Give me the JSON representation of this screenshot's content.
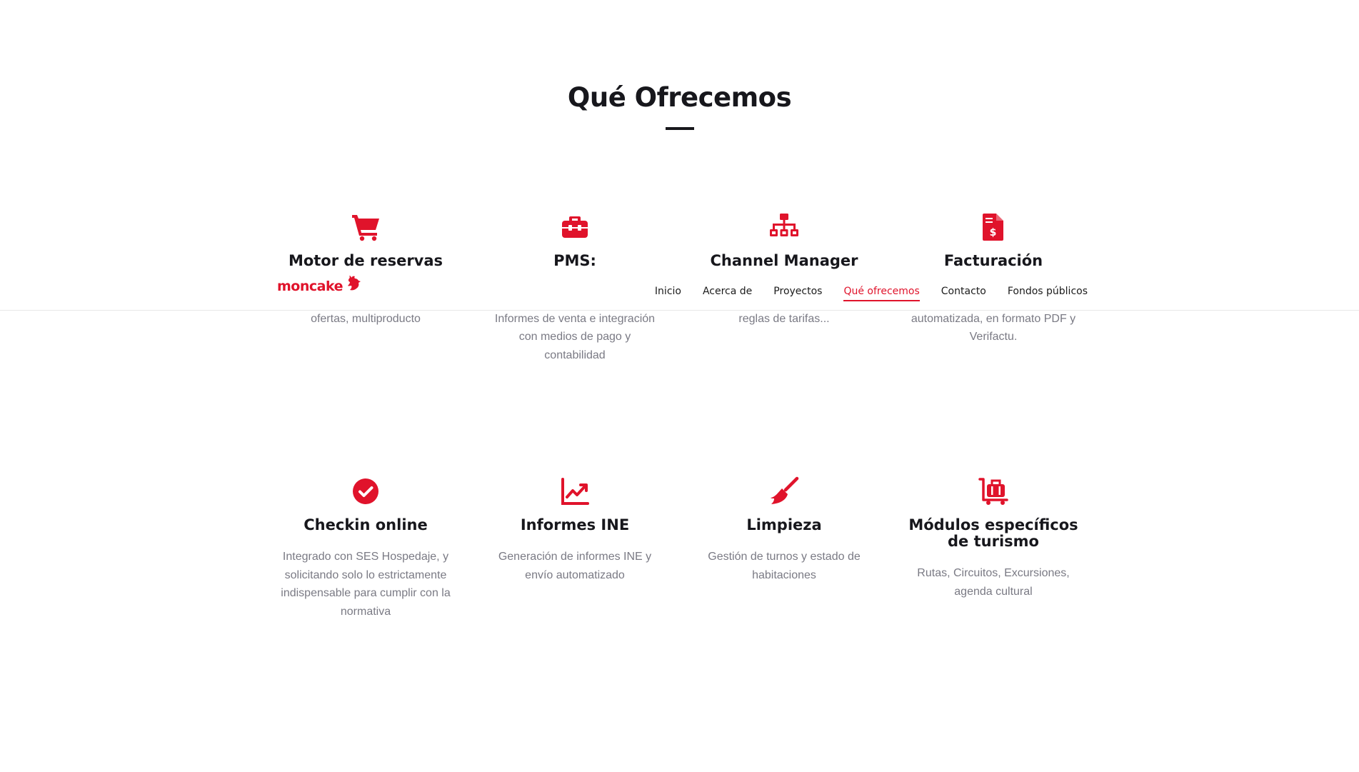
{
  "section": {
    "title": "Qué Ofrecemos"
  },
  "colors": {
    "accent": "#e0132b",
    "heading": "#17171c",
    "body_text": "#7a7a84"
  },
  "header": {
    "logo_text": "moncake",
    "nav": [
      {
        "label": "Inicio",
        "active": false
      },
      {
        "label": "Acerca de",
        "active": false
      },
      {
        "label": "Proyectos",
        "active": false
      },
      {
        "label": "Qué ofrecemos",
        "active": true
      },
      {
        "label": "Contacto",
        "active": false
      },
      {
        "label": "Fondos públicos",
        "active": false
      }
    ]
  },
  "features": [
    {
      "icon": "shopping-cart-icon",
      "title": "Motor de reservas",
      "description": "integrado, multimarca, paquetes, ofertas, multiproducto"
    },
    {
      "icon": "toolbox-icon",
      "title": "PMS:",
      "description": "Facturación y checkin online. Informes de venta e integración con medios de pago y contabilidad"
    },
    {
      "icon": "sitemap-icon",
      "title": "Channel Manager",
      "description": "portales. Revenue manager, reglas de tarifas..."
    },
    {
      "icon": "invoice-dollar-icon",
      "title": "Facturación",
      "description": "Creación de facturas automatizada, en formato PDF y Verifactu."
    },
    {
      "icon": "check-circle-icon",
      "title": "Checkin online",
      "description": "Integrado con SES Hospedaje, y solicitando solo lo estrictamente indispensable para cumplir con la normativa"
    },
    {
      "icon": "chart-line-icon",
      "title": "Informes INE",
      "description": "Generación de informes INE y envío automatizado"
    },
    {
      "icon": "broom-icon",
      "title": "Limpieza",
      "description": "Gestión de turnos y estado de habitaciones"
    },
    {
      "icon": "luggage-cart-icon",
      "title": "Módulos específicos de turismo",
      "description": "Rutas, Circuitos, Excursiones, agenda cultural"
    }
  ]
}
